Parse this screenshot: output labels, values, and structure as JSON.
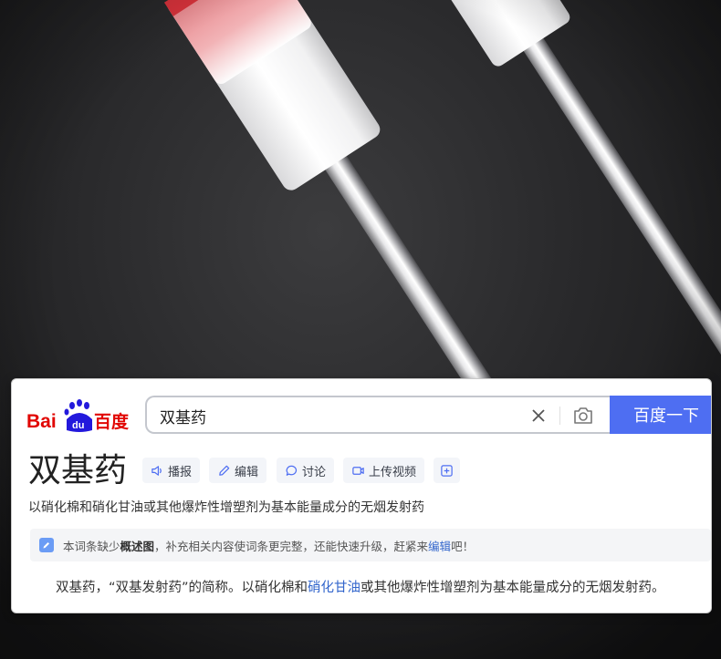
{
  "logo": {
    "text_bai": "Bai",
    "text_du": "du",
    "text_cn": "百度"
  },
  "search": {
    "value": "双基药",
    "button_label": "百度一下"
  },
  "entry": {
    "title": "双基药",
    "actions": [
      {
        "label": "播报",
        "icon": "speaker-icon"
      },
      {
        "label": "编辑",
        "icon": "pencil-icon"
      },
      {
        "label": "讨论",
        "icon": "chat-bubble-icon"
      },
      {
        "label": "上传视频",
        "icon": "video-camera-icon"
      },
      {
        "label": "",
        "icon": "plus-square-icon"
      }
    ],
    "summary": "以硝化棉和硝化甘油或其他爆炸性增塑剂为基本能量成分的无烟发射药",
    "notice": {
      "prefix": "本词条缺少",
      "bold": "概述图",
      "middle": "，补充相关内容使词条更完整，还能快速升级，赶紧来",
      "link": "编辑",
      "suffix": "吧！"
    },
    "body": {
      "part1": "双基药，“双基发射药”的简称。以硝化棉和",
      "link": "硝化甘油",
      "part2": "或其他爆炸性增塑剂为基本能量成分的无烟发射药。"
    }
  },
  "colors": {
    "brand_blue": "#4e6ef2",
    "logo_red": "#e10602",
    "logo_blue": "#2319dc",
    "link_blue": "#3366cc"
  }
}
